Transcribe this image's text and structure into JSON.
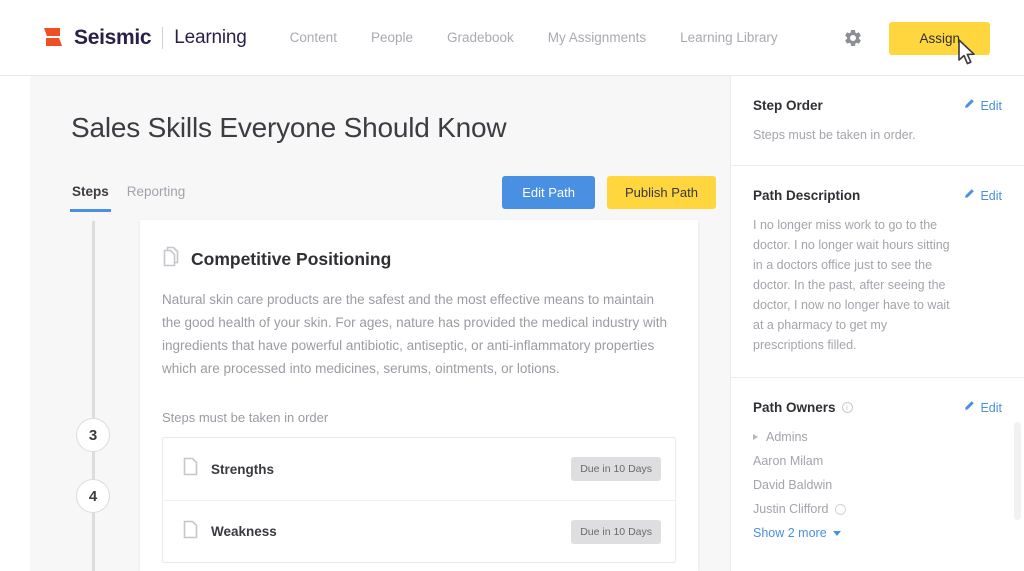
{
  "topbar": {
    "brand_name": "Seismic",
    "brand_sub": "Learning",
    "nav": [
      {
        "label": "Content"
      },
      {
        "label": "People"
      },
      {
        "label": "Gradebook"
      },
      {
        "label": "My Assignments"
      },
      {
        "label": "Learning Library"
      }
    ],
    "assign_label": "Assign",
    "accent_yellow": "#ffd63d",
    "accent_blue": "#4a90e2",
    "logo_color": "#f04e23"
  },
  "main": {
    "page_title": "Sales Skills Everyone Should Know",
    "tabs": [
      {
        "label": "Steps",
        "active": true
      },
      {
        "label": "Reporting",
        "active": false
      }
    ],
    "edit_path_label": "Edit Path",
    "publish_path_label": "Publish Path",
    "timeline_steps": [
      {
        "number": "3"
      },
      {
        "number": "4"
      }
    ],
    "card": {
      "title": "Competitive Positioning",
      "body": "Natural skin care products are the safest and the most effective means to maintain the good health of your skin. For ages, nature has provided the medical industry with ingredients that have powerful antibiotic, antiseptic, or anti-inflammatory properties which are processed into medicines, serums, ointments, or lotions.",
      "order_note": "Steps must be taken in order",
      "steps": [
        {
          "name": "Strengths",
          "due": "Due in 10 Days"
        },
        {
          "name": "Weakness",
          "due": "Due in 10 Days"
        }
      ]
    }
  },
  "sidebar": {
    "edit_label": "Edit",
    "step_order": {
      "title": "Step Order",
      "text": "Steps must be taken in order."
    },
    "path_description": {
      "title": "Path Description",
      "text": "I no longer miss work to go to the doctor. I no longer wait hours sitting in a doctors office just to see the doctor. In the past, after seeing the doctor, I now no longer have to wait at a pharmacy to get my prescriptions filled."
    },
    "path_owners": {
      "title": "Path Owners",
      "group": "Admins",
      "owners": [
        {
          "name": "Aaron Milam",
          "badge": false
        },
        {
          "name": "David Baldwin",
          "badge": false
        },
        {
          "name": "Justin Clifford",
          "badge": true
        }
      ],
      "show_more_label": "Show 2 more"
    }
  }
}
